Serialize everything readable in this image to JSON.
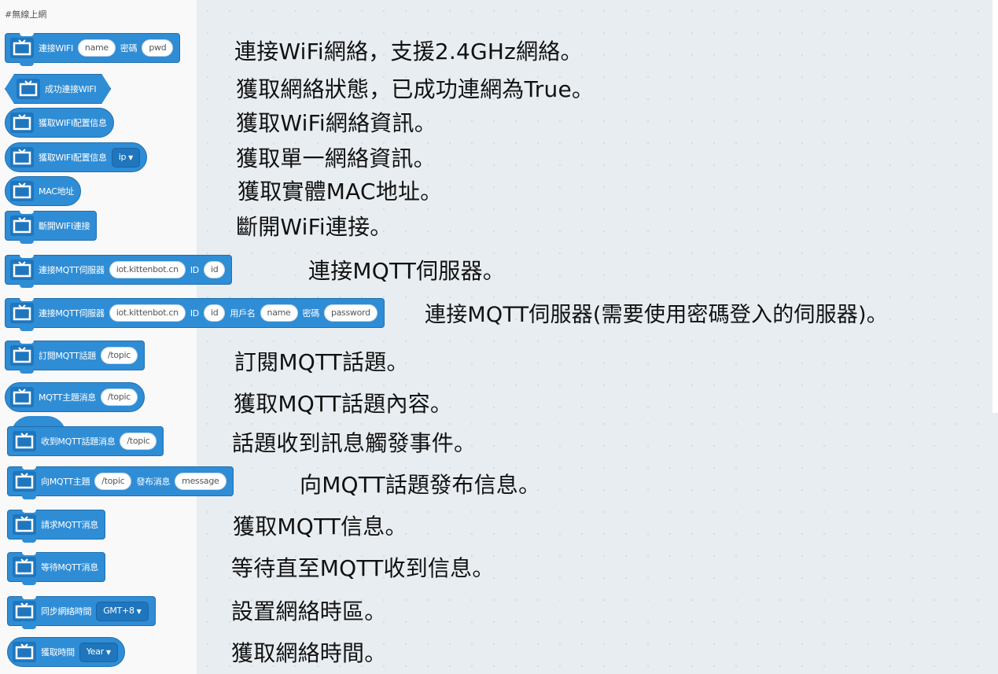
{
  "palette": {
    "category": "#無線上網"
  },
  "blocks": [
    {
      "label": "連接WIFI",
      "field1": "name",
      "label2": "密碼",
      "field2": "pwd"
    },
    {
      "label": "成功連接WIFI"
    },
    {
      "label": "獲取WIFI配置信息"
    },
    {
      "label": "獲取WIFI配置信息",
      "dropdown": "ip"
    },
    {
      "label": "MAC地址"
    },
    {
      "label": "斷開WIFI連接"
    },
    {
      "label": "連接MQTT伺服器",
      "field1": "iot.kittenbot.cn",
      "label2": "ID",
      "field2": "id"
    },
    {
      "label": "連接MQTT伺服器",
      "field1": "iot.kittenbot.cn",
      "label2": "ID",
      "field2": "id",
      "label3": "用戶名",
      "field3": "name",
      "label4": "密碼",
      "field4": "password"
    },
    {
      "label": "訂閱MQTT話題",
      "field1": "/topic"
    },
    {
      "label": "MQTT主題消息",
      "field1": "/topic"
    },
    {
      "label": "收到MQTT話題消息",
      "field1": "/topic"
    },
    {
      "label": "向MQTT主題",
      "field1": "/topic",
      "label2": "發布消息",
      "field2": "message"
    },
    {
      "label": "請求MQTT消息"
    },
    {
      "label": "等待MQTT消息"
    },
    {
      "label": "同步網絡時間",
      "dropdown": "GMT+8"
    },
    {
      "label": "獲取時間",
      "dropdown": "Year"
    }
  ],
  "descriptions": [
    "連接WiFi網絡，支援2.4GHz網絡。",
    "獲取網絡狀態，已成功連網為True。",
    "獲取WiFi網絡資訊。",
    "獲取單一網絡資訊。",
    "獲取實體MAC地址。",
    "斷開WiFi連接。",
    "連接MQTT伺服器。",
    "連接MQTT伺服器(需要使用密碼登入的伺服器)。",
    "訂閱MQTT話題。",
    "獲取MQTT話題內容。",
    "話題收到訊息觸發事件。",
    "向MQTT話題發布信息。",
    "獲取MQTT信息。",
    "等待直至MQTT收到信息。",
    "設置網絡時區。",
    "獲取網絡時間。"
  ],
  "colors": {
    "block_fill": "#2f8dd6",
    "block_border": "#1f6fae",
    "workspace": "#e8edf1",
    "palette": "#f9f9f9"
  },
  "icons": {
    "block_icon": "tv-icon",
    "dropdown_caret": "caret-down-icon"
  }
}
